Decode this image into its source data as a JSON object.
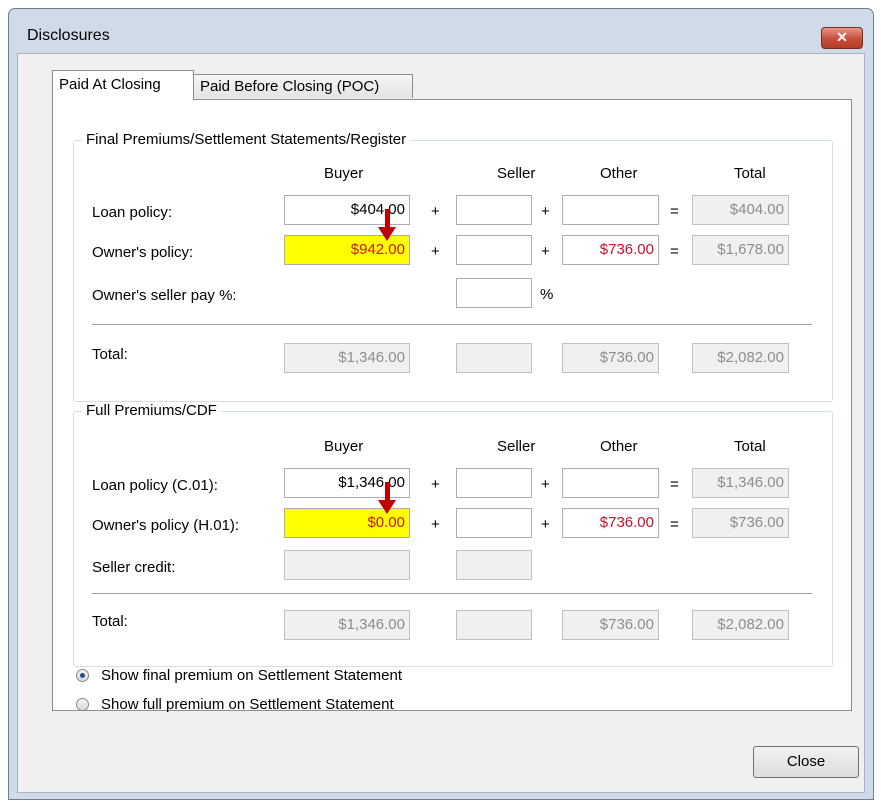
{
  "window": {
    "title": "Disclosures",
    "close_glyph": "✕"
  },
  "tabs": [
    {
      "label": "Paid At Closing",
      "active": true
    },
    {
      "label": "Paid Before Closing (POC)",
      "active": false
    }
  ],
  "final": {
    "group_label": "Final Premiums/Settlement Statements/Register",
    "headers": {
      "buyer": "Buyer",
      "seller": "Seller",
      "other": "Other",
      "total": "Total"
    },
    "rows": {
      "loan": {
        "label": "Loan policy:",
        "buyer": "$404.00",
        "seller": "",
        "other": "",
        "total": "$404.00"
      },
      "owner": {
        "label": "Owner's policy:",
        "buyer": "$942.00",
        "seller": "",
        "other": "$736.00",
        "total": "$1,678.00"
      },
      "seller_pay": {
        "label": "Owner's seller pay %:",
        "value": "",
        "pct": "%"
      }
    },
    "total": {
      "label": "Total:",
      "buyer": "$1,346.00",
      "seller": "",
      "other": "$736.00",
      "total": "$2,082.00"
    }
  },
  "full": {
    "group_label": "Full Premiums/CDF",
    "headers": {
      "buyer": "Buyer",
      "seller": "Seller",
      "other": "Other",
      "total": "Total"
    },
    "rows": {
      "loan": {
        "label": "Loan policy (C.01):",
        "buyer": "$1,346.00",
        "seller": "",
        "other": "",
        "total": "$1,346.00"
      },
      "owner": {
        "label": "Owner's policy (H.01):",
        "buyer": "$0.00",
        "seller": "",
        "other": "$736.00",
        "total": "$736.00"
      },
      "seller_credit": {
        "label": "Seller credit:",
        "buyer": "",
        "seller": ""
      }
    },
    "total": {
      "label": "Total:",
      "buyer": "$1,346.00",
      "seller": "",
      "other": "$736.00",
      "total": "$2,082.00"
    }
  },
  "operators": {
    "plus": "+",
    "equals": "="
  },
  "radios": [
    {
      "label": "Show final premium on Settlement Statement",
      "checked": true
    },
    {
      "label": "Show full premium on Settlement Statement",
      "checked": false
    }
  ],
  "buttons": {
    "close": "Close"
  },
  "colors": {
    "highlight": "#ffff00",
    "highlight_text": "#d01818",
    "arrow": "#c00000",
    "other_text": "#c8102e"
  }
}
